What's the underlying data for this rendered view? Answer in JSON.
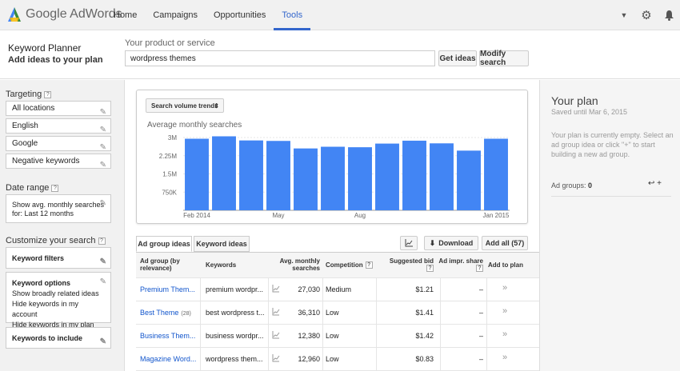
{
  "topbar": {
    "logo_text": "Google AdWords",
    "nav": [
      "Home",
      "Campaigns",
      "Opportunities",
      "Tools"
    ],
    "active_nav": "Tools",
    "icons": [
      "dropdown-icon",
      "gear-icon",
      "bell-icon"
    ]
  },
  "header": {
    "title": "Keyword Planner",
    "subtitle": "Add ideas to your plan",
    "product_label": "Your product or service",
    "product_value": "wordpress themes",
    "get_ideas": "Get ideas",
    "modify_search": "Modify search"
  },
  "sidebar": {
    "targeting_label": "Targeting",
    "targeting": [
      "All locations",
      "English",
      "Google",
      "Negative keywords"
    ],
    "date_range_label": "Date range",
    "date_range_line1": "Show avg. monthly searches",
    "date_range_line2": "for: Last 12 months",
    "customize_label": "Customize your search",
    "keyword_filters": "Keyword filters",
    "keyword_options": "Keyword options",
    "keyword_options_items": [
      "Show broadly related ideas",
      "Hide keywords in my account",
      "Hide keywords in my plan"
    ],
    "keywords_to_include": "Keywords to include",
    "help_glyph": "?"
  },
  "chart_card": {
    "dropdown_label": "Search volume trends",
    "dropdown_arrow": "⇕"
  },
  "chart_data": {
    "type": "bar",
    "title": "Average monthly searches",
    "y_ticks": [
      "3M",
      "2.25M",
      "1.5M",
      "750K"
    ],
    "y_tick_values": [
      3000000,
      2250000,
      1500000,
      750000
    ],
    "ylim": [
      0,
      3000000
    ],
    "x_tick_labels": [
      "Feb 2014",
      "May",
      "Aug",
      "Jan 2015"
    ],
    "x_tick_indices": [
      0,
      3,
      6,
      11
    ],
    "values": [
      2950000,
      3050000,
      2880000,
      2860000,
      2550000,
      2620000,
      2600000,
      2750000,
      2870000,
      2760000,
      2460000,
      2950000
    ],
    "color": "#4285f4",
    "grid": true
  },
  "tabs": {
    "ad_group_ideas": "Ad group ideas",
    "keyword_ideas": "Keyword ideas",
    "chart_icon": "chart-icon",
    "download": "Download",
    "add_all": "Add all (57)"
  },
  "table": {
    "headers": {
      "ad_group": "Ad group (by relevance)",
      "keywords": "Keywords",
      "avg_monthly": "Avg. monthly searches",
      "competition": "Competition",
      "suggested_bid": "Suggested bid",
      "ad_impr_share": "Ad impr. share",
      "add_to_plan": "Add to plan",
      "help_glyph": "?"
    },
    "rows": [
      {
        "ad_group": "Premium Them...",
        "count": "",
        "keywords": "premium wordpr...",
        "searches": "27,030",
        "competition": "Medium",
        "bid": "$1.21",
        "share": "–",
        "add": "»"
      },
      {
        "ad_group": "Best Theme",
        "count": "(28)",
        "keywords": "best wordpress t...",
        "searches": "36,310",
        "competition": "Low",
        "bid": "$1.41",
        "share": "–",
        "add": "»"
      },
      {
        "ad_group": "Business Them...",
        "count": "",
        "keywords": "business wordpr...",
        "searches": "12,380",
        "competition": "Low",
        "bid": "$1.42",
        "share": "–",
        "add": "»"
      },
      {
        "ad_group": "Magazine Word...",
        "count": "",
        "keywords": "wordpress them...",
        "searches": "12,960",
        "competition": "Low",
        "bid": "$0.83",
        "share": "–",
        "add": "»"
      }
    ]
  },
  "plan": {
    "title": "Your plan",
    "saved": "Saved until Mar 6, 2015",
    "empty": "Your plan is currently empty. Select an ad group idea or click \"+\" to start building a new ad group.",
    "ad_groups_label": "Ad groups:",
    "ad_groups_count": "0",
    "icons": "↩ +"
  }
}
